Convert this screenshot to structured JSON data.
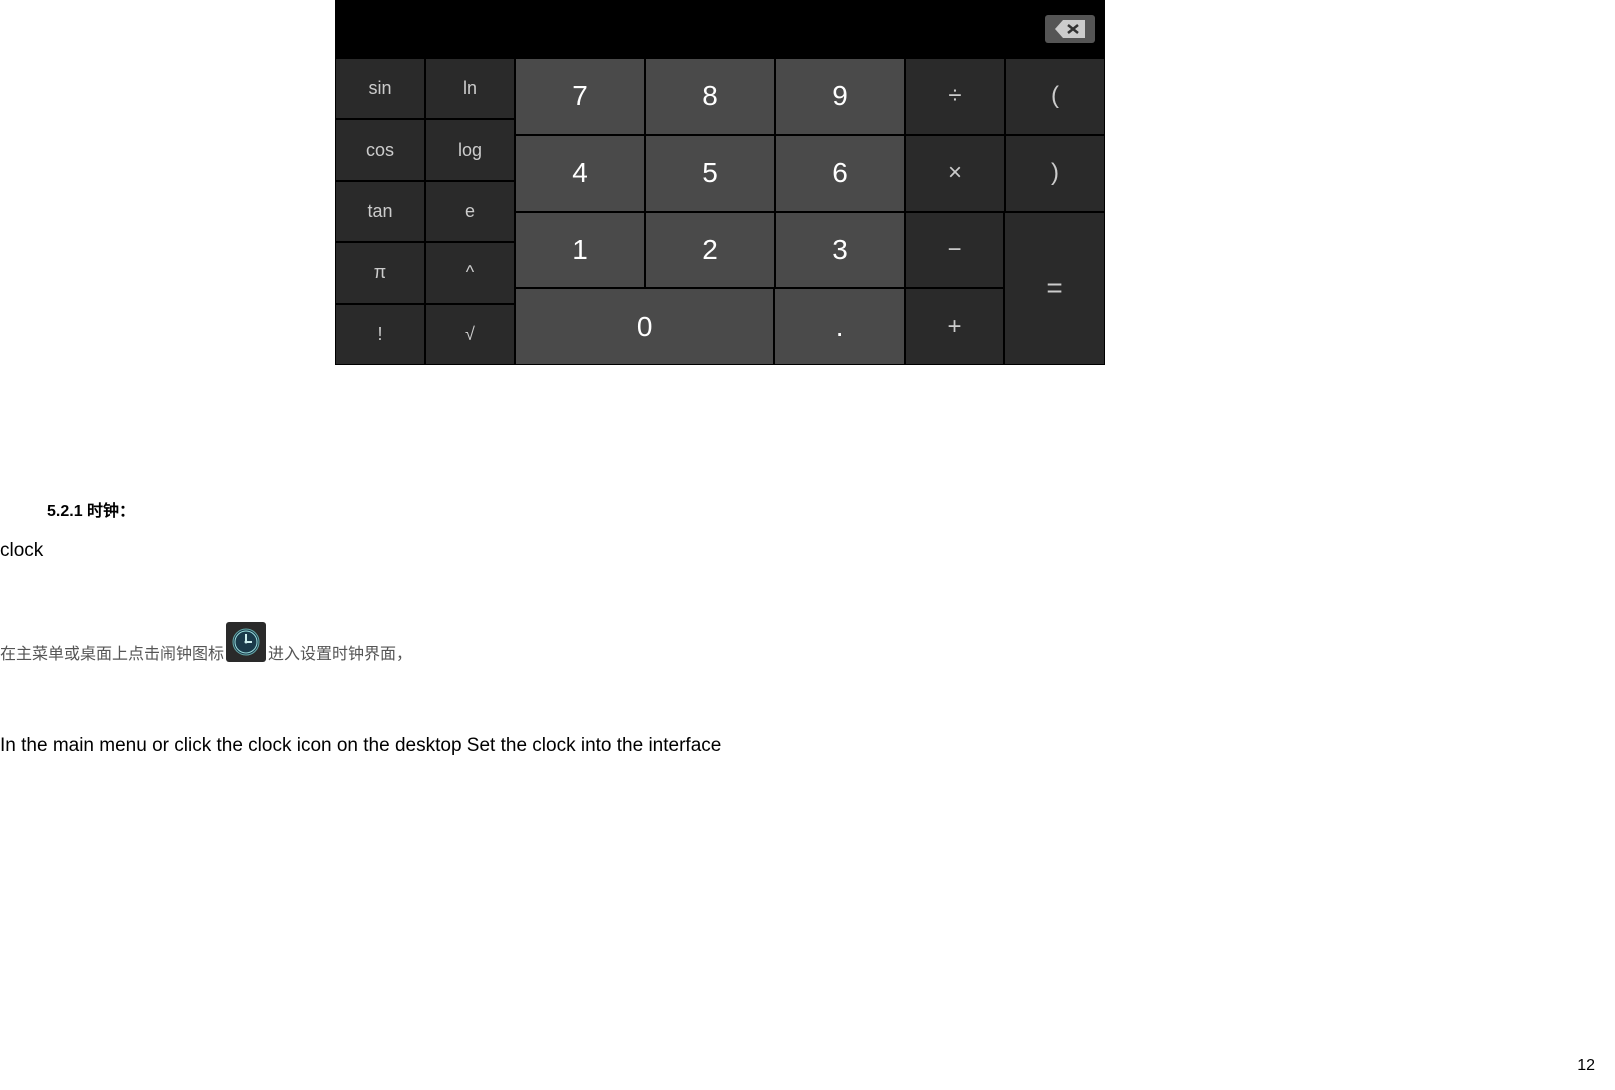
{
  "calculator": {
    "backspace": "×",
    "func_keys": [
      [
        "sin",
        "ln"
      ],
      [
        "cos",
        "log"
      ],
      [
        "tan",
        "e"
      ],
      [
        "π",
        "^"
      ],
      [
        "!",
        "√"
      ]
    ],
    "num_rows": [
      [
        "7",
        "8",
        "9"
      ],
      [
        "4",
        "5",
        "6"
      ],
      [
        "1",
        "2",
        "3"
      ]
    ],
    "zero_row": [
      "0",
      "."
    ],
    "op_rows": [
      [
        "÷",
        "("
      ],
      [
        "×",
        ")"
      ],
      [
        "−"
      ],
      [
        "+"
      ]
    ],
    "equals": "="
  },
  "section": {
    "number": "5.2.1",
    "title_cn": "时钟：",
    "title_en": "clock"
  },
  "text": {
    "cn_before": "在主菜单或桌面上点击闹钟图标",
    "cn_after": "进入设置时钟界面，",
    "en": "In the main menu or click the clock icon on the desktop Set the clock into the interface"
  },
  "page_number": "12"
}
